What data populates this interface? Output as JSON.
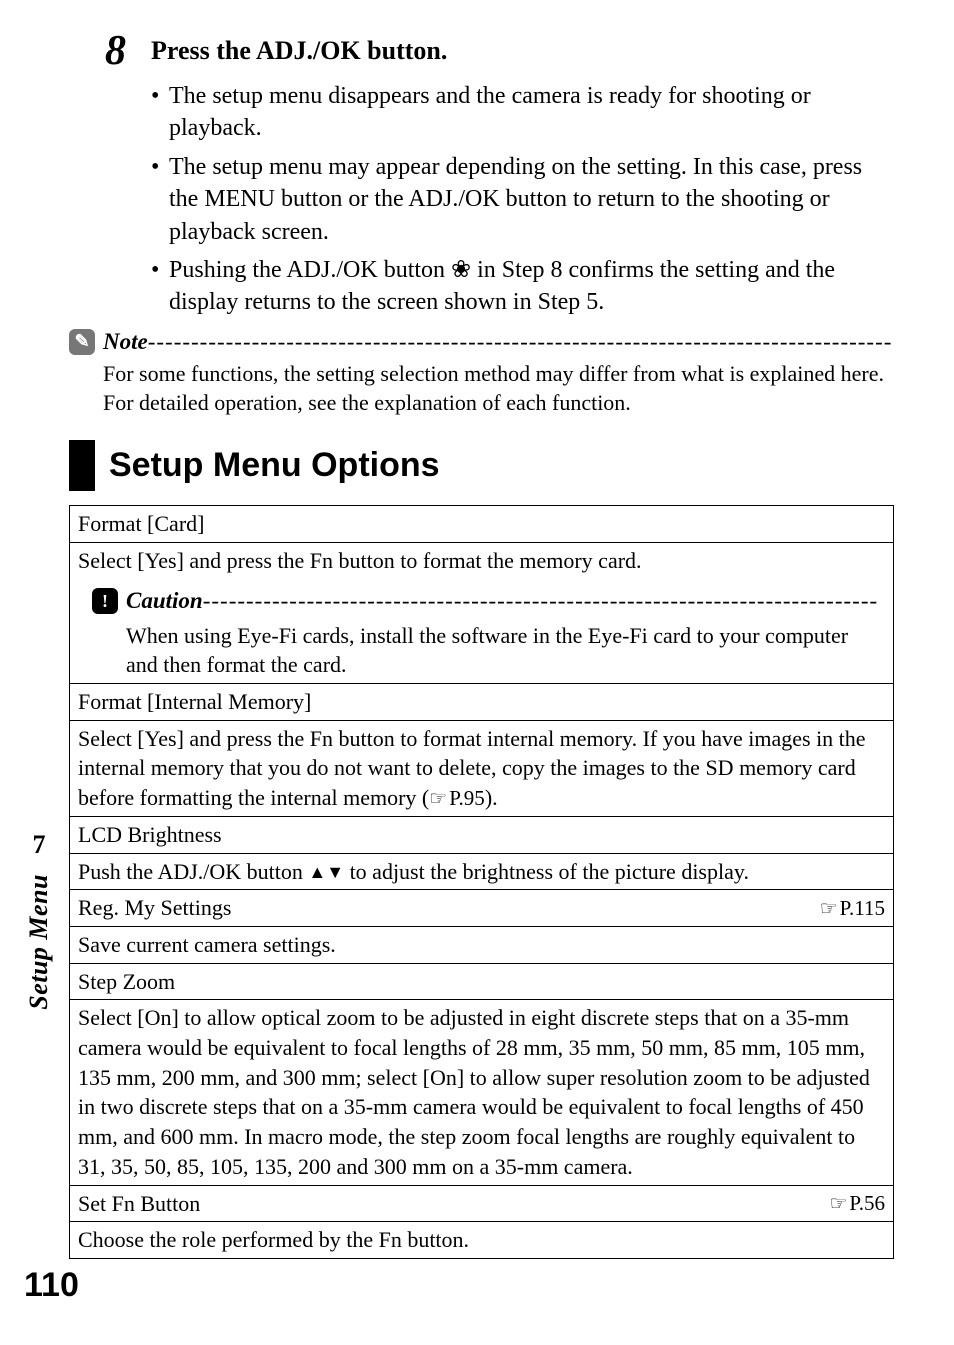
{
  "step": {
    "number": "8",
    "title": "Press the ADJ./OK button.",
    "bullets": [
      "The setup menu disappears and the camera is ready for shooting or playback.",
      "The setup menu may appear depending on the setting. In this case, press the MENU button or the ADJ./OK button to return to the shooting or playback screen.",
      "Pushing the ADJ./OK button ❀ in Step 8 confirms the setting and the display returns to the screen shown in Step 5."
    ]
  },
  "note": {
    "label": "Note",
    "dashes": "--------------------------------------------------------------------------------------",
    "body": "For some functions, the setting selection method may differ from what is explained here. For detailed operation, see the explanation of each function."
  },
  "section_title": "Setup Menu Options",
  "caution": {
    "label": "Caution",
    "dashes": "------------------------------------------------------------------------------",
    "body": "When using Eye-Fi cards, install the software in the Eye-Fi card to your computer and then format the card."
  },
  "options": {
    "format_card": {
      "title": "Format [Card]",
      "body": "Select [Yes] and press the Fn button to format the memory card."
    },
    "format_internal": {
      "title": "Format [Internal Memory]",
      "body_pre": "Select [Yes] and press the Fn button to format internal memory. If you have images in the internal memory that you do not want to delete, copy the images to the SD memory card before formatting the internal memory (",
      "body_ref": "P.95",
      "body_post": ")."
    },
    "lcd": {
      "title": "LCD Brightness",
      "body_pre": "Push the ADJ./OK button ",
      "body_post": " to adjust the brightness of the picture display."
    },
    "reg": {
      "title": "Reg. My Settings",
      "ref": "P.115",
      "body": "Save current camera settings."
    },
    "stepzoom": {
      "title": "Step Zoom",
      "body": "Select [On] to allow optical zoom to be adjusted in eight discrete steps that on a 35-mm camera would be equivalent to focal lengths of 28 mm, 35 mm, 50 mm, 85 mm, 105 mm, 135 mm, 200 mm, and 300 mm; select [On] to allow super resolution zoom to be adjusted in two discrete steps that on a 35-mm camera would be equivalent to focal lengths of 450 mm, and 600 mm. In macro mode, the step zoom focal lengths are roughly equivalent to 31, 35, 50, 85, 105, 135, 200 and 300 mm on a 35-mm camera."
    },
    "setfn": {
      "title": "Set Fn Button",
      "ref": "P.56",
      "body": "Choose the role performed by the Fn button."
    }
  },
  "sidebar": {
    "chapter_num": "7",
    "chapter_title": "Setup Menu"
  },
  "page_number": "110"
}
